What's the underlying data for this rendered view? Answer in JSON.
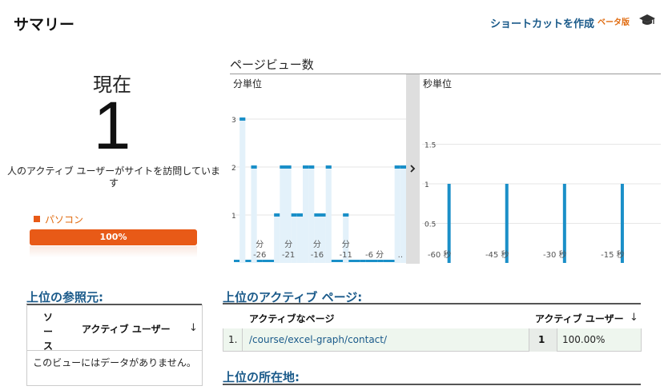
{
  "header": {
    "title": "サマリー",
    "shortcut_label": "ショートカットを作成",
    "beta_label": "ベータ版",
    "help_icon": "graduation-cap-icon"
  },
  "realtime": {
    "now_label": "現在",
    "active_count": "1",
    "description": "人のアクティブ ユーザーがサイトを訪問しています",
    "device_label": "パソコン",
    "device_percent_label": "100%",
    "device_share": 1.0,
    "device_color": "#e85a17"
  },
  "pageviews": {
    "title": "ページビュー数",
    "minute_label": "分単位",
    "second_label": "秒単位"
  },
  "chart_data": [
    {
      "type": "bar",
      "title": "分単位",
      "ylim": [
        0,
        3.3
      ],
      "yticks": [
        1,
        2,
        3
      ],
      "xticks": [
        {
          "unit": "分",
          "value": "-26",
          "at": -26
        },
        {
          "unit": "分",
          "value": "-21",
          "at": -21
        },
        {
          "unit": "分",
          "value": "-16",
          "at": -16
        },
        {
          "unit": "分",
          "value": "-11",
          "at": -11
        },
        {
          "unit": "",
          "value": "-6 分",
          "at": -6
        },
        {
          "unit": "",
          "value": "..",
          "at": -1.5
        }
      ],
      "x": [
        -30,
        -29,
        -28,
        -27,
        -26,
        -25,
        -24,
        -23,
        -22,
        -21,
        -20,
        -19,
        -18,
        -17,
        -16,
        -15,
        -14,
        -13,
        -12,
        -11,
        -10,
        -9,
        -8,
        -7,
        -6,
        -5,
        -4,
        -3,
        -2,
        -1
      ],
      "values": [
        0,
        3,
        0,
        2,
        0,
        0,
        0,
        1,
        2,
        2,
        1,
        1,
        2,
        2,
        1,
        1,
        2,
        0,
        0,
        1,
        0,
        0,
        0,
        0,
        0,
        0,
        0,
        0,
        2,
        2
      ],
      "color": "#1a8fc8",
      "fill_color": "#e3f1fa",
      "grid": true
    },
    {
      "type": "bar",
      "title": "秒単位",
      "ylim": [
        0,
        2.0
      ],
      "yticks": [
        0.5,
        1,
        1.5
      ],
      "ytick_labels": [
        "0.5",
        "1",
        "1.5"
      ],
      "xticks": [
        {
          "value": "-60 秒",
          "at": -60
        },
        {
          "value": "-45 秒",
          "at": -45
        },
        {
          "value": "-30 秒",
          "at": -30
        },
        {
          "value": "-15 秒",
          "at": -15
        }
      ],
      "x": [
        -55,
        -40,
        -25,
        -10
      ],
      "values": [
        1,
        1,
        1,
        1
      ],
      "color": "#1a8fc8",
      "grid": true
    }
  ],
  "referrers": {
    "title": "上位の参照元:",
    "col_source": "ソース",
    "col_users": "アクティブ ユーザー",
    "sort_icon": "arrow-down-icon",
    "empty_message": "このビューにはデータがありません。"
  },
  "active_pages": {
    "title": "上位のアクティブ ページ:",
    "col_page": "アクティブなページ",
    "col_users": "アクティブ ユーザー",
    "rows": [
      {
        "index": "1.",
        "url": "/course/excel-graph/contact/",
        "users": "1",
        "percent": "100.00%"
      }
    ]
  },
  "locations": {
    "title": "上位の所在地:"
  }
}
